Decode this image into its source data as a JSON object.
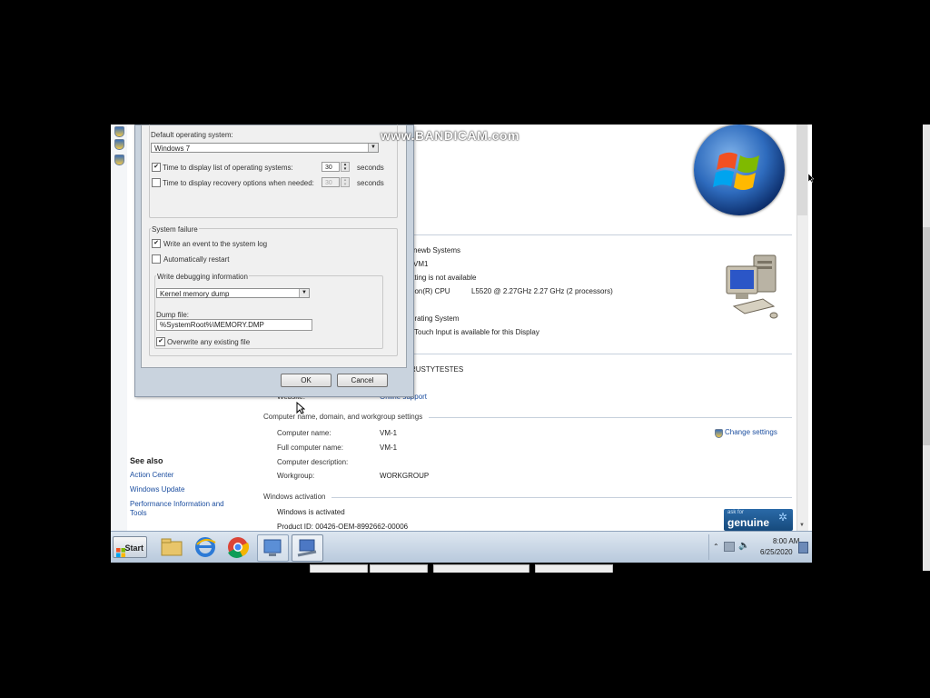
{
  "watermark": "www.BANDICAM.com",
  "dialog": {
    "default_os_label": "Default operating system:",
    "default_os_value": "Windows 7",
    "time_list_label": "Time to display list of operating systems:",
    "time_list_value": "30",
    "time_recovery_label": "Time to display recovery options when needed:",
    "time_recovery_value": "30",
    "seconds_1": "seconds",
    "seconds_2": "seconds",
    "system_failure_title": "System failure",
    "write_event_label": "Write an event to the system log",
    "auto_restart_label": "Automatically restart",
    "debug_info_title": "Write debugging information",
    "debug_type_value": "Kernel memory dump",
    "dump_file_label": "Dump file:",
    "dump_file_value": "%SystemRoot%\\MEMORY.DMP",
    "overwrite_label": "Overwrite any existing file",
    "ok_label": "OK",
    "cancel_label": "Cancel",
    "checks": {
      "time_list": true,
      "time_recovery": false,
      "write_event": true,
      "auto_restart": false,
      "overwrite": true
    }
  },
  "system": {
    "manufacturer_partial": "newb Systems",
    "model_partial": "VM1",
    "rating_partial": "ating is not available",
    "processor_partial": "eon(R) CPU",
    "processor_model": "L5520  @ 2.27GHz   2.27 GHz  (2 processors)",
    "system_type_partial": "erating System",
    "pen_touch_partial": "Touch Input is available for this Display",
    "support_partial": "RUSTYTESTES",
    "website_label": "Website:",
    "website_value": "Online support"
  },
  "computer_section": {
    "title": "Computer name, domain, and workgroup settings",
    "rows": [
      {
        "label": "Computer name:",
        "value": "VM-1"
      },
      {
        "label": "Full computer name:",
        "value": "VM-1"
      },
      {
        "label": "Computer description:",
        "value": ""
      },
      {
        "label": "Workgroup:",
        "value": "WORKGROUP"
      }
    ],
    "change_settings": "Change settings"
  },
  "activation_section": {
    "title": "Windows activation",
    "status": "Windows is activated",
    "product_id": "Product ID: 00426-OEM-8992662-00006",
    "genuine_top": "ask for",
    "genuine_main": "genuine"
  },
  "see_also": {
    "title": "See also",
    "links": [
      "Action Center",
      "Windows Update",
      "Performance Information and Tools"
    ]
  },
  "taskbar": {
    "start_label": "Start",
    "time": "8:00 AM",
    "date": "6/25/2020",
    "apps": [
      "explorer-icon",
      "ie-icon",
      "chrome-icon",
      "network-icon",
      "system-properties-icon"
    ]
  },
  "colors": {
    "link": "#1d4fa0",
    "taskbar": "#c8d6e6",
    "genuine_blue": "#1f5e99"
  }
}
